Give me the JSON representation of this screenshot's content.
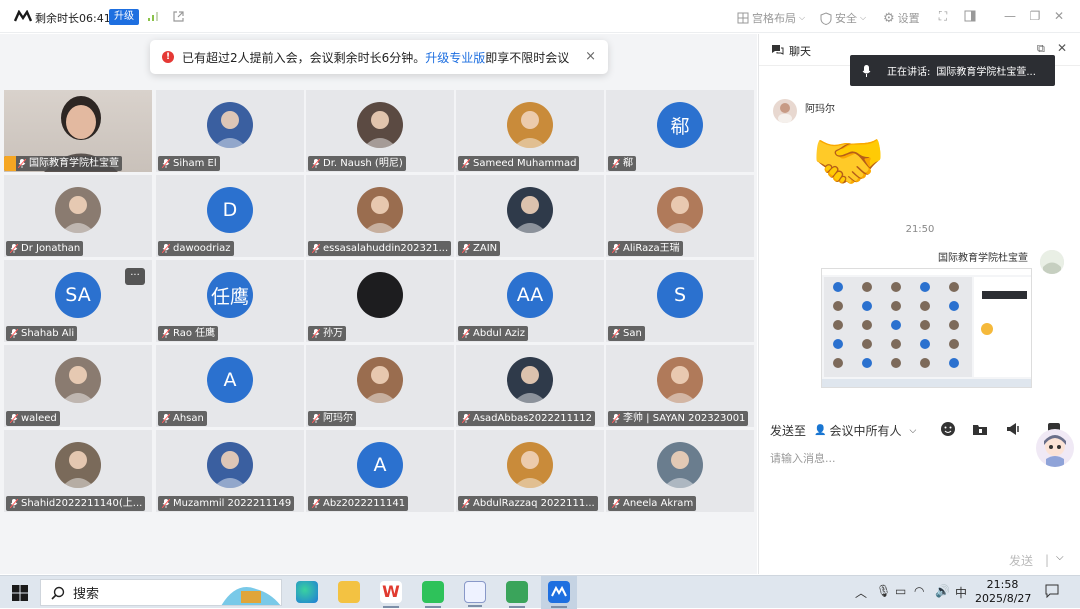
{
  "titlebar": {
    "remaining_time": "剩余时长06:41",
    "upgrade_label": "升级",
    "layout_label": "宫格布局",
    "security_label": "安全",
    "settings_label": "设置"
  },
  "toast": {
    "text_before": "已有超过2人提前入会，会议剩余时长6分钟。",
    "link_text": "升级专业版",
    "text_after": "即享不限时会议",
    "close": "×"
  },
  "participants": [
    {
      "name": "国际教育学院杜宝萱",
      "avatar": "photo",
      "host": true,
      "active": true
    },
    {
      "name": "Siham El",
      "avatar": "photo"
    },
    {
      "name": "Dr. Naush (明尼)",
      "avatar": "photo"
    },
    {
      "name": "Sameed Muhammad",
      "avatar": "photo"
    },
    {
      "name": "郗",
      "avatar": "郗"
    },
    {
      "name": "Dr Jonathan",
      "avatar": "photo"
    },
    {
      "name": "dawoodriaz",
      "avatar": "D"
    },
    {
      "name": "essasalahuddin202321...",
      "avatar": "photo"
    },
    {
      "name": "ZAIN",
      "avatar": "photo"
    },
    {
      "name": "AliRaza王瑞",
      "avatar": "photo"
    },
    {
      "name": "Shahab Ali",
      "avatar": "SA"
    },
    {
      "name": "Rao 任鹰",
      "avatar": "任鹰"
    },
    {
      "name": "孙万",
      "avatar": "photo-dark"
    },
    {
      "name": "Abdul Aziz",
      "avatar": "AA"
    },
    {
      "name": "San",
      "avatar": "S"
    },
    {
      "name": "waleed",
      "avatar": "photo"
    },
    {
      "name": "Ahsan",
      "avatar": "A"
    },
    {
      "name": "阿玛尔",
      "avatar": "photo"
    },
    {
      "name": "AsadAbbas2022211112",
      "avatar": "photo"
    },
    {
      "name": "李帅 | SAYAN 202323001",
      "avatar": "photo"
    },
    {
      "name": "Shahid2022211140(上...",
      "avatar": "photo"
    },
    {
      "name": "Muzammil 2022211149",
      "avatar": "photo"
    },
    {
      "name": "Abz2022211141",
      "avatar": "A"
    },
    {
      "name": "AbdulRazzaq 2022111...",
      "avatar": "photo"
    },
    {
      "name": "Aneela Akram",
      "avatar": "photo"
    }
  ],
  "tile_more_label": "···",
  "chat": {
    "title": "聊天",
    "speaking_label": "正在讲话:",
    "speaking_name": "国际教育学院杜宝萱...",
    "msg_sender": "阿玛尔",
    "msg_emoji": "🤝",
    "time_separator": "21:50",
    "self_sender": "国际教育学院杜宝萱",
    "send_to_label": "发送至",
    "send_to_target": "会议中所有人",
    "input_placeholder": "请输入消息...",
    "send_button": "发送"
  },
  "taskbar": {
    "search_label": "搜索",
    "ime": "中",
    "time": "21:58",
    "date": "2025/8/27"
  },
  "colors": {
    "accent": "#1e6fe0",
    "avatar_blue": "#2b71cf",
    "active_border": "#3cc26d",
    "toast_error": "#e53935"
  }
}
